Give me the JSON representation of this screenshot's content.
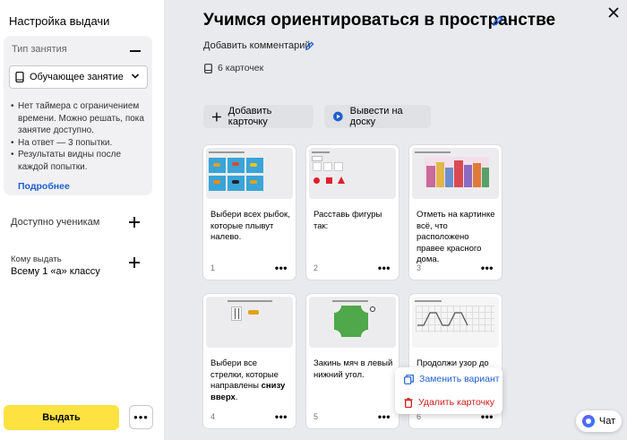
{
  "sidebar": {
    "title": "Настройка выдачи",
    "type_block": {
      "heading": "Тип занятия",
      "selected": "Обучающее занятие",
      "bullets": [
        "Нет таймера с ограничением времени. Можно решать, пока занятие доступно.",
        "На ответ — 3 попытки.",
        "Результаты видны после каждой попытки."
      ],
      "more_link": "Подробнее"
    },
    "available_label": "Доступно ученикам",
    "who_label": "Кому выдать",
    "who_value": "Всему 1 «а» классу",
    "issue_button": "Выдать"
  },
  "main": {
    "title": "Учимся ориентироваться в пространстве",
    "comment_link": "Добавить комментарий",
    "cards_count": "6 карточек",
    "add_card_button": "Добавить карточку",
    "show_on_board_button": "Вывести на доску",
    "cards": [
      {
        "number": "1",
        "text_plain": "Выбери всех рыбок, которые плывут налево.",
        "text_bold": "",
        "text_after": ""
      },
      {
        "number": "2",
        "text_plain": "Расставь фигуры так:",
        "text_bold": "",
        "text_after": ""
      },
      {
        "number": "3",
        "text_plain": "Отметь на картинке всё, что расположено правее красного дома.",
        "text_bold": "",
        "text_after": ""
      },
      {
        "number": "4",
        "text_plain": "Выбери все стрелки, которые направлены ",
        "text_bold": "снизу вверх",
        "text_after": "."
      },
      {
        "number": "5",
        "text_plain": "Закинь мяч в левый нижний угол.",
        "text_bold": "",
        "text_after": ""
      },
      {
        "number": "6",
        "text_plain": "Продолжи узор до",
        "text_bold": "",
        "text_after": ""
      }
    ],
    "context_menu": {
      "replace": "Заменить вариант",
      "delete": "Удалить карточку"
    },
    "chat_button": "Чат"
  },
  "colors": {
    "accent_yellow": "#fde242",
    "link_blue": "#1f5fd1",
    "danger_red": "#d11a1a",
    "background": "#e9eaed"
  },
  "icons": [
    "minus-icon",
    "chevron-down-icon",
    "phone-icon",
    "plus-icon",
    "pencil-icon",
    "cards-icon",
    "play-icon",
    "close-icon",
    "replace-icon",
    "trash-icon",
    "chat-icon",
    "more-dots-icon"
  ]
}
